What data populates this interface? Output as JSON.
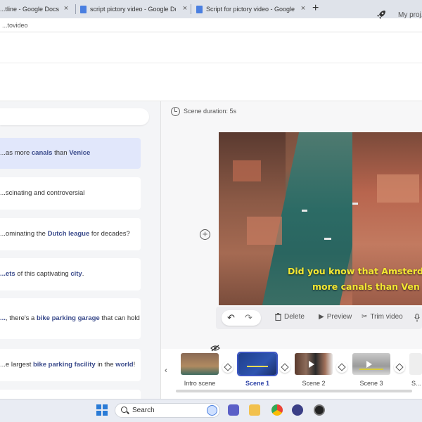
{
  "browser": {
    "tabs": [
      {
        "label": "...tline - Google Docs"
      },
      {
        "label": "script pictory video - Google Docs"
      },
      {
        "label": "Script for pictory video - Google Docs"
      }
    ],
    "new_tab": "+",
    "close": "×",
    "address": "...tovideo"
  },
  "header": {
    "my_projects": "My proj..."
  },
  "script_cards": [
    {
      "pre": "...as more ",
      "b1": "canals",
      "mid": " than ",
      "b2": "Venice",
      "post": ""
    },
    {
      "pre": "...scinating and controversial",
      "b1": "",
      "mid": "",
      "b2": "",
      "post": ""
    },
    {
      "pre": "...ominating the ",
      "b1": "Dutch league",
      "mid": " for decades?",
      "b2": "",
      "post": ""
    },
    {
      "pre": "",
      "b1": "...ets",
      "mid": " of this captivating ",
      "b2": "city",
      "post": "."
    },
    {
      "pre": "",
      "b1": "...",
      "mid": ", there's a ",
      "b2": "bike parking garage",
      "post": " that can hold"
    },
    {
      "pre": "...e largest ",
      "b1": "bike parking facility",
      "mid": " in the ",
      "b2": "world",
      "post": "!"
    }
  ],
  "editor": {
    "scene_duration": "Scene duration:  5s",
    "add_scene": "+",
    "caption_line1": "Did you know that Amsterd",
    "caption_line2": "more canals than Ven",
    "toolbar": {
      "undo": "↶",
      "redo": "↷",
      "delete": "Delete",
      "preview": "Preview",
      "trim": "Trim video"
    }
  },
  "timeline": {
    "scroll_left": "‹",
    "scenes": [
      {
        "label": "Intro scene"
      },
      {
        "label": "Scene 1"
      },
      {
        "label": "Scene 2"
      },
      {
        "label": "Scene 3"
      },
      {
        "label": "S..."
      }
    ]
  },
  "taskbar": {
    "search": "Search"
  },
  "colors": {
    "accent": "#3d56c4",
    "highlight_word": "#3c4c8c",
    "caption_yellow": "#f4e832",
    "active_card": "#e1e7fb"
  }
}
